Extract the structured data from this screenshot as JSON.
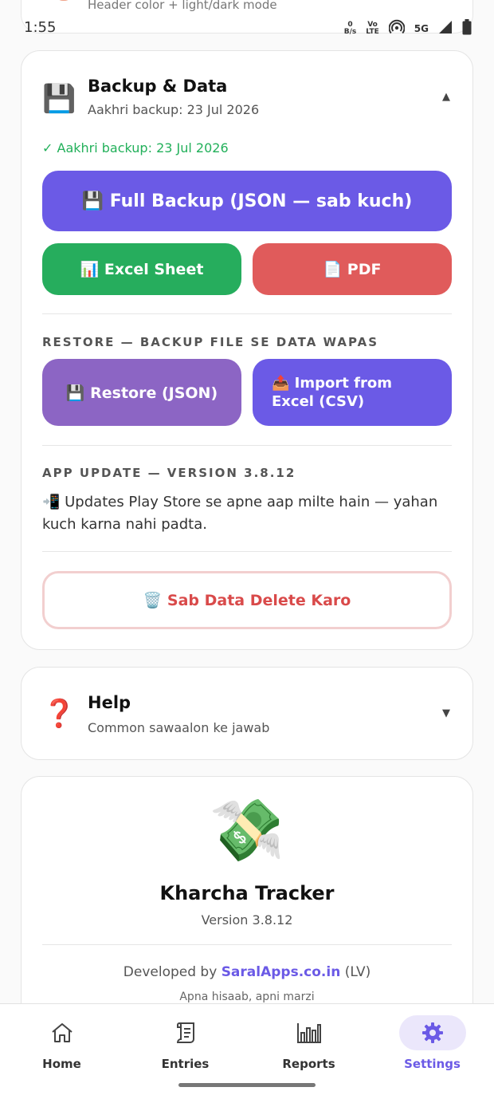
{
  "peek": {
    "text": "Header color + light/dark mode"
  },
  "status": {
    "time": "1:55",
    "data_rate_top": "0",
    "data_rate_bottom": "B/s",
    "volte_top": "Vo",
    "volte_bottom": "LTE",
    "network": "5G"
  },
  "backup_card": {
    "icon": "💾",
    "title": "Backup & Data",
    "subtitle": "Aakhri backup: 23 Jul 2026",
    "chevron": "▲",
    "success_text": "✓ Aakhri backup: 23 Jul 2026",
    "full_backup_label": "💾 Full Backup (JSON — sab kuch)",
    "excel_label": "📊 Excel Sheet",
    "pdf_label": "📄 PDF",
    "restore_section_label": "RESTORE — BACKUP FILE SE DATA WAPAS",
    "restore_label": "💾 Restore (JSON)",
    "import_label": "📤 Import from Excel (CSV)",
    "update_section_label": "APP UPDATE — VERSION 3.8.12",
    "update_text": "📲 Updates Play Store se apne aap milte hain — yahan kuch karna nahi padta.",
    "delete_label": "🗑️ Sab Data Delete Karo"
  },
  "help_card": {
    "icon": "❓",
    "title": "Help",
    "subtitle": "Common sawaalon ke jawab",
    "chevron": "▼"
  },
  "about_card": {
    "icon": "💸",
    "app_name": "Kharcha Tracker",
    "version": "Version 3.8.12",
    "developed_by_prefix": "Developed by ",
    "developer_link": "SaralApps.co.in",
    "developed_by_suffix": " (LV)",
    "tagline": "Apna hisaab, apni marzi"
  },
  "nav": {
    "items": [
      {
        "label": "Home",
        "icon": "home-icon"
      },
      {
        "label": "Entries",
        "icon": "receipt-icon"
      },
      {
        "label": "Reports",
        "icon": "bar-chart-icon"
      },
      {
        "label": "Settings",
        "icon": "gear-icon"
      }
    ],
    "active": "Settings",
    "accent": "#6b5ae6"
  },
  "colors": {
    "primary": "#6b5ae6",
    "excel": "#26ad5d",
    "pdf": "#e05b5b",
    "restore": "#8c65c4",
    "danger": "#d94a4a",
    "success": "#22b05a"
  }
}
